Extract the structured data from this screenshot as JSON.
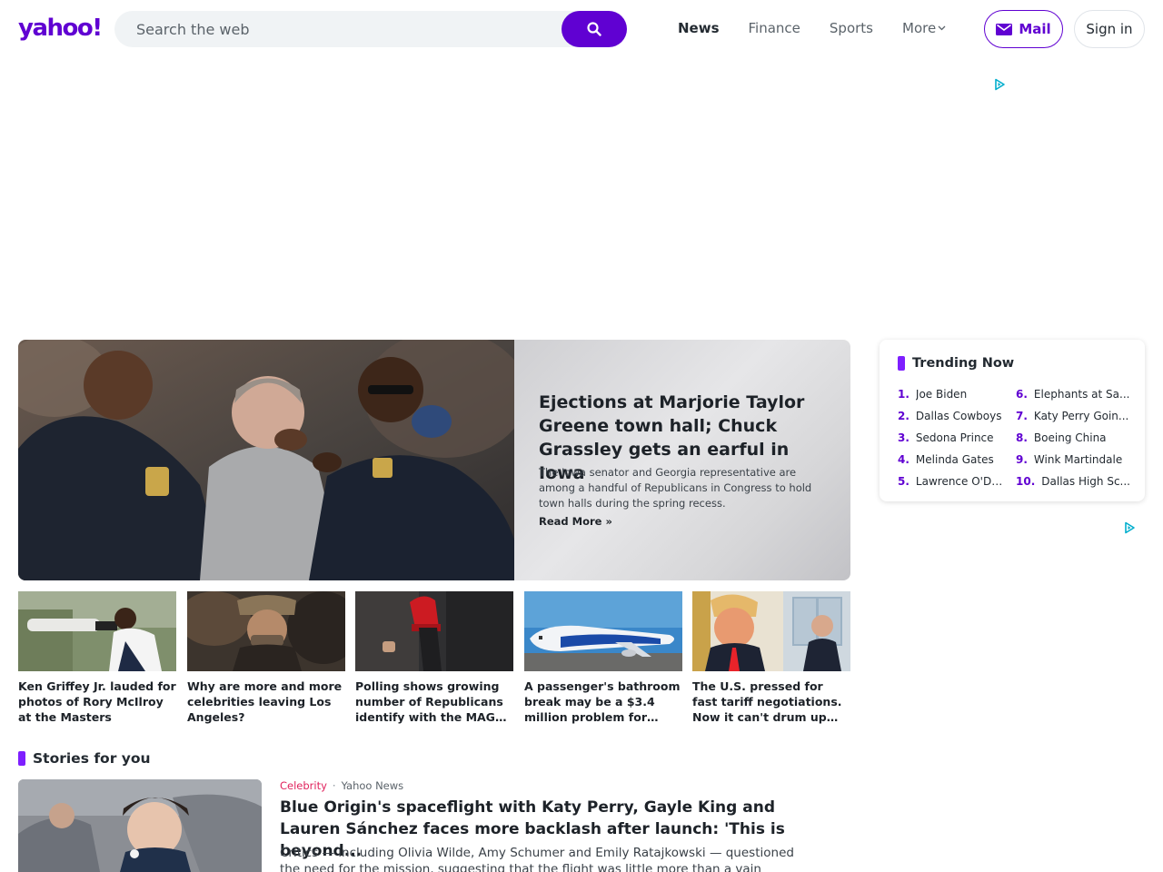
{
  "header": {
    "logo_text": "yahoo!",
    "search_placeholder": "Search the web",
    "nav": {
      "news": "News",
      "finance": "Finance",
      "sports": "Sports",
      "more": "More"
    },
    "mail_label": "Mail",
    "signin_label": "Sign in"
  },
  "hero": {
    "title": "Ejections at Marjorie Taylor Greene town hall; Chuck Grassley gets an earful in Iowa",
    "description": "The Iowa senator and Georgia representative are among a handful of Republicans in Congress to hold town halls during the spring recess.",
    "read_more": "Read More »"
  },
  "thumbnails": [
    {
      "title": "Ken Griffey Jr. lauded for photos of Rory McIlroy at the Masters"
    },
    {
      "title": "Why are more and more celebrities leaving Los Angeles?"
    },
    {
      "title": "Polling shows growing number of Republicans identify with the MAGA movement"
    },
    {
      "title": "A passenger's bathroom break may be a $3.4 million problem for airlines"
    },
    {
      "title": "The U.S. pressed for fast tariff negotiations. Now it can't drum up enough deals"
    }
  ],
  "trending": {
    "title": "Trending Now",
    "items": [
      {
        "num": "1.",
        "text": "Joe Biden"
      },
      {
        "num": "2.",
        "text": "Dallas Cowboys"
      },
      {
        "num": "3.",
        "text": "Sedona Prince"
      },
      {
        "num": "4.",
        "text": "Melinda Gates"
      },
      {
        "num": "5.",
        "text": "Lawrence O'Do..."
      },
      {
        "num": "6.",
        "text": "Elephants at Sa..."
      },
      {
        "num": "7.",
        "text": "Katy Perry Goin..."
      },
      {
        "num": "8.",
        "text": "Boeing China"
      },
      {
        "num": "9.",
        "text": "Wink Martindale"
      },
      {
        "num": "10.",
        "text": "Dallas High Sc..."
      }
    ]
  },
  "stories": {
    "section_title": "Stories for you",
    "first": {
      "category": "Celebrity",
      "separator": "·",
      "source": "Yahoo News",
      "title": "Blue Origin's spaceflight with Katy Perry, Gayle King and Lauren Sánchez faces more backlash after launch: 'This is beyond...",
      "description": "Critics — including Olivia Wilde, Amy Schumer and Emily Ratajkowski — questioned the need for the mission, suggesting that the flight was little more than a vain publicity"
    }
  },
  "colors": {
    "brand_purple": "#6001d2",
    "accent_purple": "#7e1fff",
    "category_red": "#e0245e",
    "adchoice_cyan": "#00aecd"
  },
  "icons": [
    "search-icon",
    "mail-icon",
    "chevron-down-icon",
    "adchoices-icon"
  ]
}
